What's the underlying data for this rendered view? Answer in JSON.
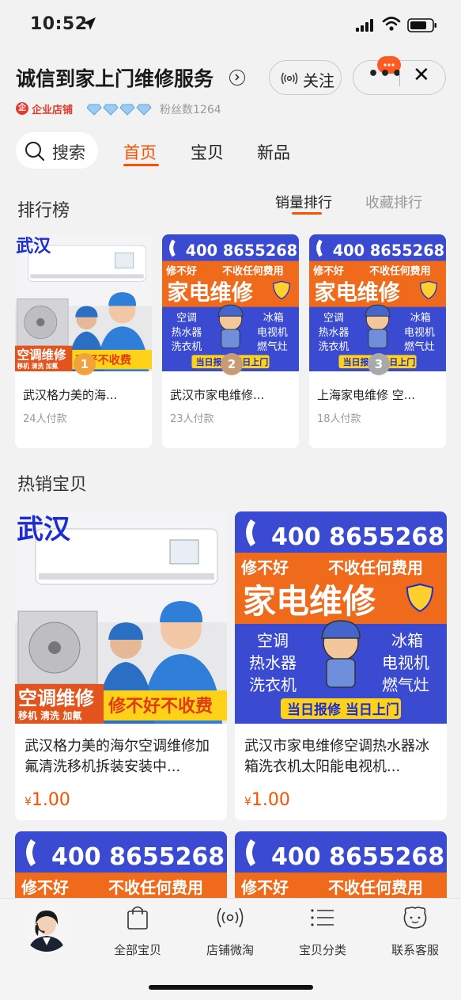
{
  "status_bar": {
    "time": "10:52"
  },
  "header": {
    "shop_name": "诚信到家上门维修服务",
    "follow_label": "关注",
    "more_label": "•••",
    "close_label": "✕",
    "enterprise_badge": "企业店铺",
    "enterprise_mark": "企",
    "diamond_count": 4,
    "fans_text": "粉丝数1264"
  },
  "nav": {
    "search_label": "搜索",
    "tabs": [
      {
        "label": "首页",
        "active": true
      },
      {
        "label": "宝贝",
        "active": false
      },
      {
        "label": "新品",
        "active": false
      }
    ]
  },
  "ranking": {
    "title": "排行榜",
    "sort_tabs": [
      {
        "label": "销量排行",
        "active": true
      },
      {
        "label": "收藏排行",
        "active": false
      }
    ],
    "items": [
      {
        "rank": "1",
        "name": "武汉格力美的海...",
        "sold": "24人付款",
        "image": "ac"
      },
      {
        "rank": "2",
        "name": "武汉市家电维修...",
        "sold": "23人付款",
        "image": "repair"
      },
      {
        "rank": "3",
        "name": "上海家电维修 空...",
        "sold": "18人付款",
        "image": "repair"
      }
    ]
  },
  "hot": {
    "title": "热销宝贝",
    "items": [
      {
        "name": "武汉格力美的海尔空调维修加氟清洗移机拆装安装中...",
        "currency": "¥",
        "price": "1.00",
        "image": "ac"
      },
      {
        "name": "武汉市家电维修空调热水器冰箱洗衣机太阳能电视机...",
        "currency": "¥",
        "price": "1.00",
        "image": "repair"
      }
    ]
  },
  "poster_ac": {
    "city": "武汉",
    "service": "空调维修",
    "sub": "移机 清洗 加氟",
    "guarantee": "修不好不收费",
    "guarantee_short": "不好不收费"
  },
  "poster_repair": {
    "phone": "400 8655268",
    "left_slogan": "修不好",
    "right_slogan": "不收任何费用",
    "headline": "家电维修",
    "appliances_left": [
      "空调",
      "热水器",
      "洗衣机"
    ],
    "appliances_right": [
      "冰箱",
      "电视机",
      "燃气灶"
    ],
    "same_day": "当日报修 当日上门",
    "same_day_short": "当日报修 当日上门"
  },
  "bottom_bar": {
    "items": [
      {
        "label": "全部宝贝",
        "icon": "bag-icon"
      },
      {
        "label": "店铺微淘",
        "icon": "broadcast-icon"
      },
      {
        "label": "宝贝分类",
        "icon": "list-icon"
      },
      {
        "label": "联系客服",
        "icon": "service-face-icon"
      }
    ]
  },
  "colors": {
    "accent": "#ff5000",
    "poster_blue": "#3b4bd1",
    "poster_orange": "#f06a1c",
    "enterprise_red": "#e23a2e"
  }
}
